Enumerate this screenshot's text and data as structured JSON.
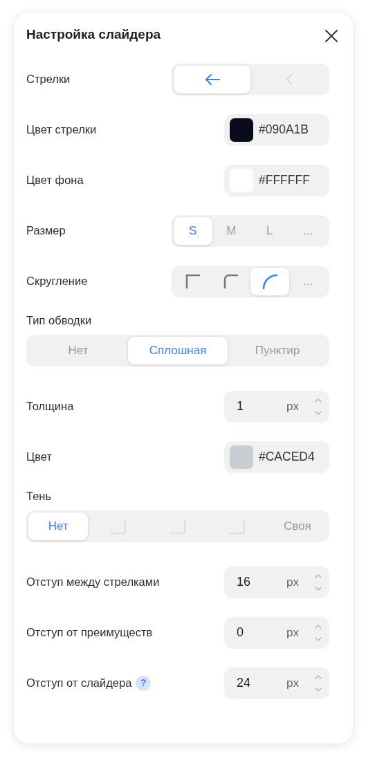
{
  "title": "Настройка слайдера",
  "rows": [
    {
      "kind": "segmented",
      "label": "Стрелки",
      "options": [
        {
          "kind": "arrow",
          "selected": true
        },
        {
          "kind": "chevron",
          "selected": false
        }
      ]
    },
    {
      "kind": "color",
      "label": "Цвет стрелки",
      "color": "#090a1b",
      "value": "#090A1B"
    },
    {
      "kind": "color",
      "label": "Цвет фона",
      "color": "#ffffff",
      "value": "#FFFFFF"
    },
    {
      "kind": "segmented",
      "label": "Размер",
      "options": [
        {
          "kind": "text",
          "text": "S",
          "selected": true
        },
        {
          "kind": "text",
          "text": "M",
          "selected": false
        },
        {
          "kind": "text",
          "text": "L",
          "selected": false
        },
        {
          "kind": "text",
          "text": "...",
          "selected": false
        }
      ]
    },
    {
      "kind": "segmented",
      "label": "Скругление",
      "options": [
        {
          "kind": "corner-sharp",
          "selected": false
        },
        {
          "kind": "corner-soft",
          "selected": false
        },
        {
          "kind": "corner-round",
          "selected": true
        },
        {
          "kind": "text",
          "text": "...",
          "selected": false
        }
      ]
    },
    {
      "kind": "wide",
      "label": "Тип обводки",
      "options": [
        {
          "kind": "text",
          "text": "Нет",
          "selected": false
        },
        {
          "kind": "text",
          "text": "Сплошная",
          "selected": true
        },
        {
          "kind": "text",
          "text": "Пунктир",
          "selected": false
        }
      ]
    },
    {
      "kind": "number",
      "label": "Толщина",
      "value": "1",
      "unit": "px"
    },
    {
      "kind": "color",
      "label": "Цвет",
      "color": "#caced4",
      "value": "#CACED4"
    },
    {
      "kind": "wide",
      "label": "Тень",
      "options": [
        {
          "kind": "text",
          "text": "Нет",
          "selected": true
        },
        {
          "kind": "shadow",
          "selected": false
        },
        {
          "kind": "shadow",
          "selected": false
        },
        {
          "kind": "shadow",
          "selected": false
        },
        {
          "kind": "text",
          "text": "Своя",
          "selected": false
        }
      ]
    },
    {
      "kind": "number",
      "label": "Отступ между стрелками",
      "value": "16",
      "unit": "px"
    },
    {
      "kind": "number",
      "label": "Отступ от преимуществ",
      "value": "0",
      "unit": "px"
    },
    {
      "kind": "number",
      "label": "Отступ от слайдера",
      "help": "?",
      "value": "24",
      "unit": "px"
    }
  ]
}
